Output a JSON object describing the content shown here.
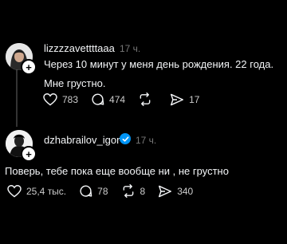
{
  "posts": [
    {
      "username": "lizzzzavettttaaa",
      "time": "17 ч.",
      "text": "Через 10 минут у меня день рождения. 22 года. Мне грустно.",
      "likes": "783",
      "comments": "474",
      "reposts": "",
      "shares": "17"
    },
    {
      "username": "dzhabrailov_igor",
      "time": "17 ч.",
      "text": "Поверь, тебе пока еще вообще ни , не грустно",
      "likes": "25,4 тыс.",
      "comments": "78",
      "reposts": "8",
      "shares": "340"
    }
  ],
  "icons": {
    "like": "heart-icon",
    "comment": "comment-icon",
    "repost": "repost-icon",
    "share": "send-icon",
    "verified": "verified-badge-icon",
    "follow": "plus-icon"
  },
  "colors": {
    "background": "#000000",
    "text": "#f3f5f7",
    "muted": "#777777",
    "verified": "#0095f6"
  }
}
